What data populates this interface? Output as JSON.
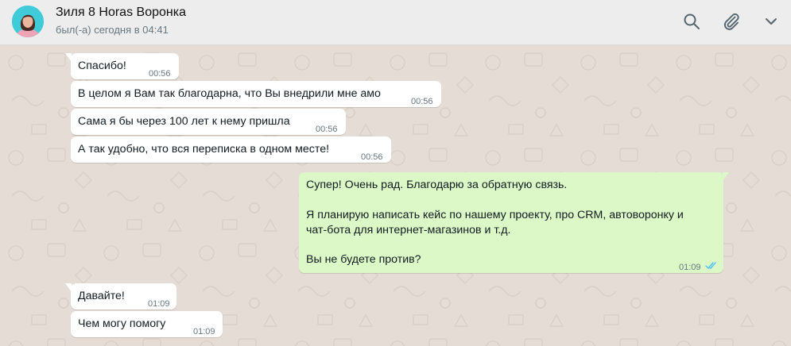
{
  "header": {
    "name": "Зиля 8 Horas Воронка",
    "status": "был(-а) сегодня в 04:41",
    "icons": [
      "search-icon",
      "paperclip-icon",
      "chevron-down-icon"
    ]
  },
  "colors": {
    "chat_bg": "#e5ddd5",
    "incoming": "#ffffff",
    "outgoing": "#dcf8c6",
    "read_ticks": "#4fc3f7"
  },
  "messages": {
    "m1": {
      "text": "Спасибо!",
      "time": "00:56"
    },
    "m2": {
      "text": "В целом я Вам так благодарна, что Вы внедрили мне амо",
      "time": "00:56"
    },
    "m3": {
      "text": "Сама я бы через 100 лет к нему пришла",
      "time": "00:56"
    },
    "m4": {
      "text": "А так удобно, что вся переписка в одном месте!",
      "time": "00:56"
    },
    "m5": {
      "line1": "Супер! Очень рад. Благодарю за обратную связь.",
      "line2": "Я планирую написать кейс по нашему проекту, про CRM, автоворонку и",
      "line3": "чат-бота для интернет-магазинов и т.д.",
      "line4": "Вы не будете против?",
      "time": "01:09",
      "status": "read"
    },
    "m6": {
      "text": "Давайте!",
      "time": "01:09"
    },
    "m7": {
      "text": "Чем могу помогу",
      "time": "01:09"
    }
  }
}
